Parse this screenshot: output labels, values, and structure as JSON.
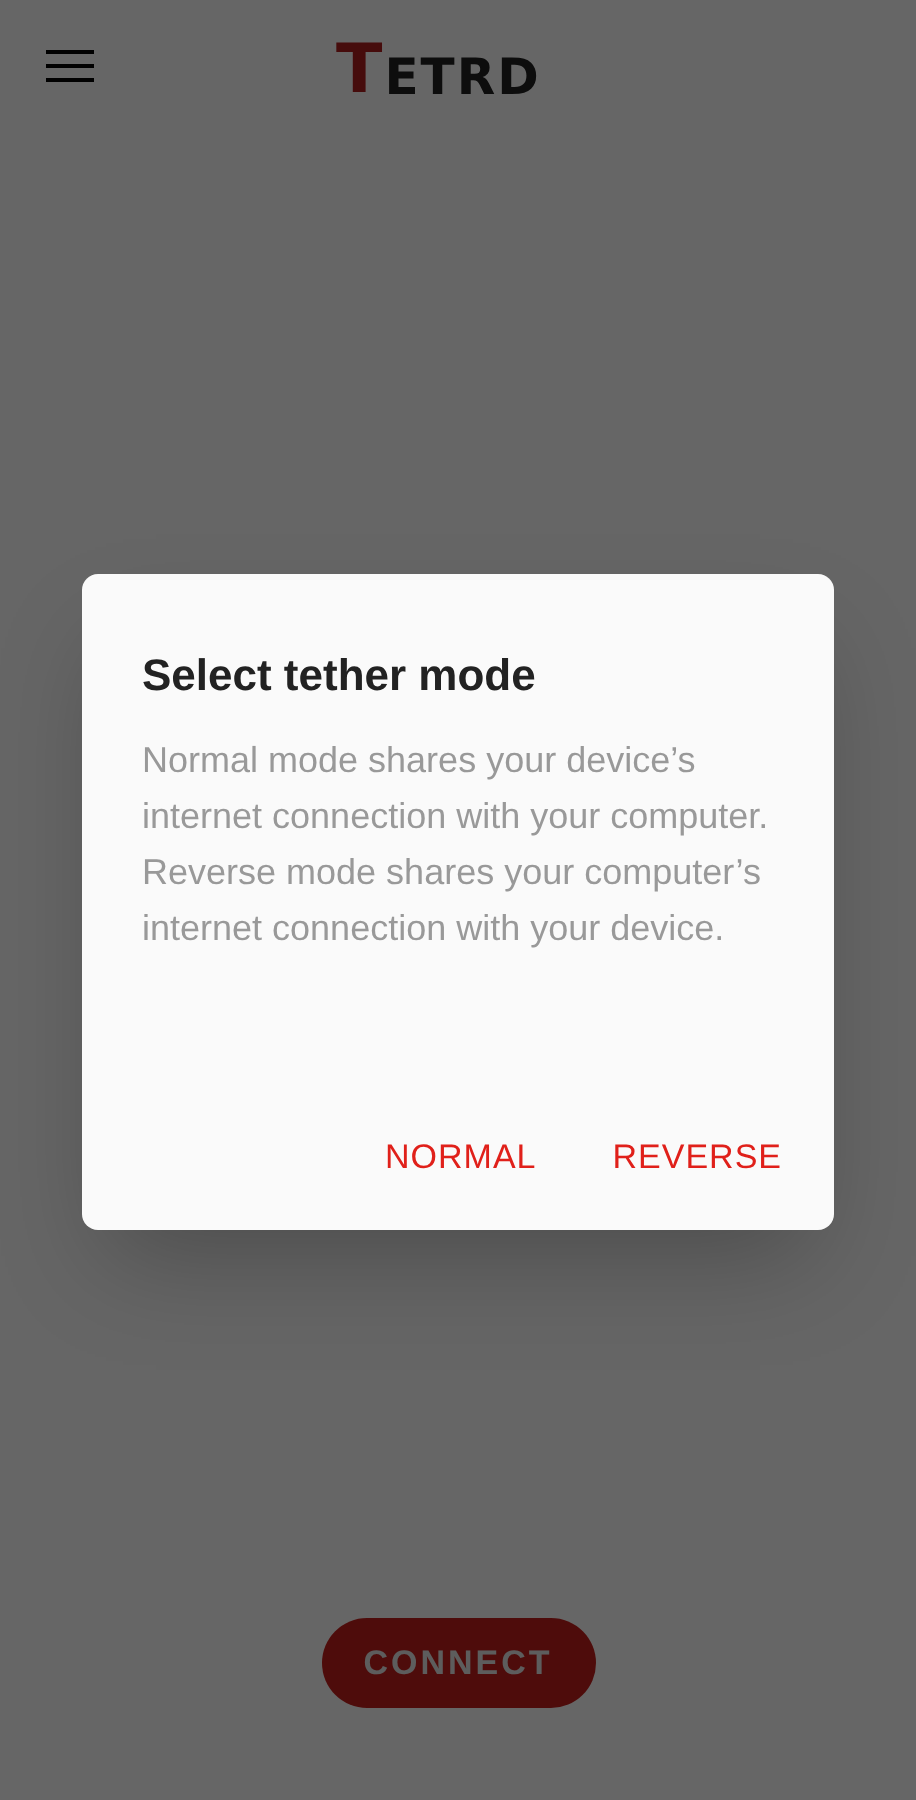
{
  "app_bar": {
    "logo": {
      "first_letter": "T",
      "rest": "ETRD"
    }
  },
  "connect_button": {
    "label": "CONNECT"
  },
  "dialog": {
    "title": "Select tether mode",
    "message": "Normal mode shares your device’s internet connection with your computer. Reverse mode shares your computer’s internet connection with your device.",
    "actions": [
      "NORMAL",
      "REVERSE"
    ]
  }
}
